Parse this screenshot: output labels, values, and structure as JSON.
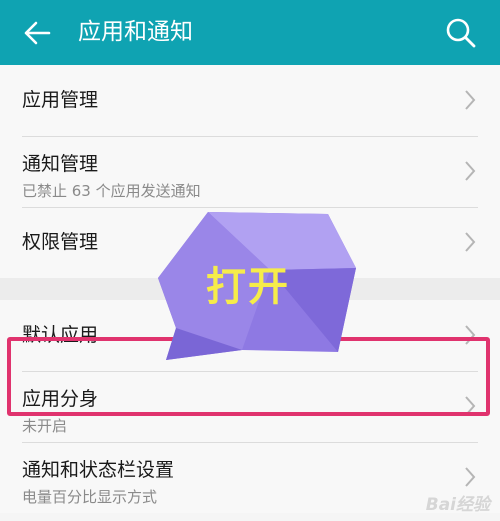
{
  "appbar": {
    "title": "应用和通知",
    "back_icon": "back-arrow-icon",
    "search_icon": "search-icon",
    "background": "#0fa3b2"
  },
  "items": [
    {
      "title": "应用管理",
      "subtitle": ""
    },
    {
      "title": "通知管理",
      "subtitle": "已禁止 63 个应用发送通知"
    },
    {
      "title": "权限管理",
      "subtitle": ""
    },
    {
      "title": "默认应用",
      "subtitle": ""
    },
    {
      "title": "应用分身",
      "subtitle": "未开启"
    },
    {
      "title": "通知和状态栏设置",
      "subtitle": "电量百分比显示方式"
    }
  ],
  "annotation": {
    "text": "打开",
    "highlight_color": "#e0336e",
    "callout_color": "#9a86e8",
    "text_color": "#f6ec4a"
  },
  "watermark": {
    "text": "Bai经验"
  }
}
